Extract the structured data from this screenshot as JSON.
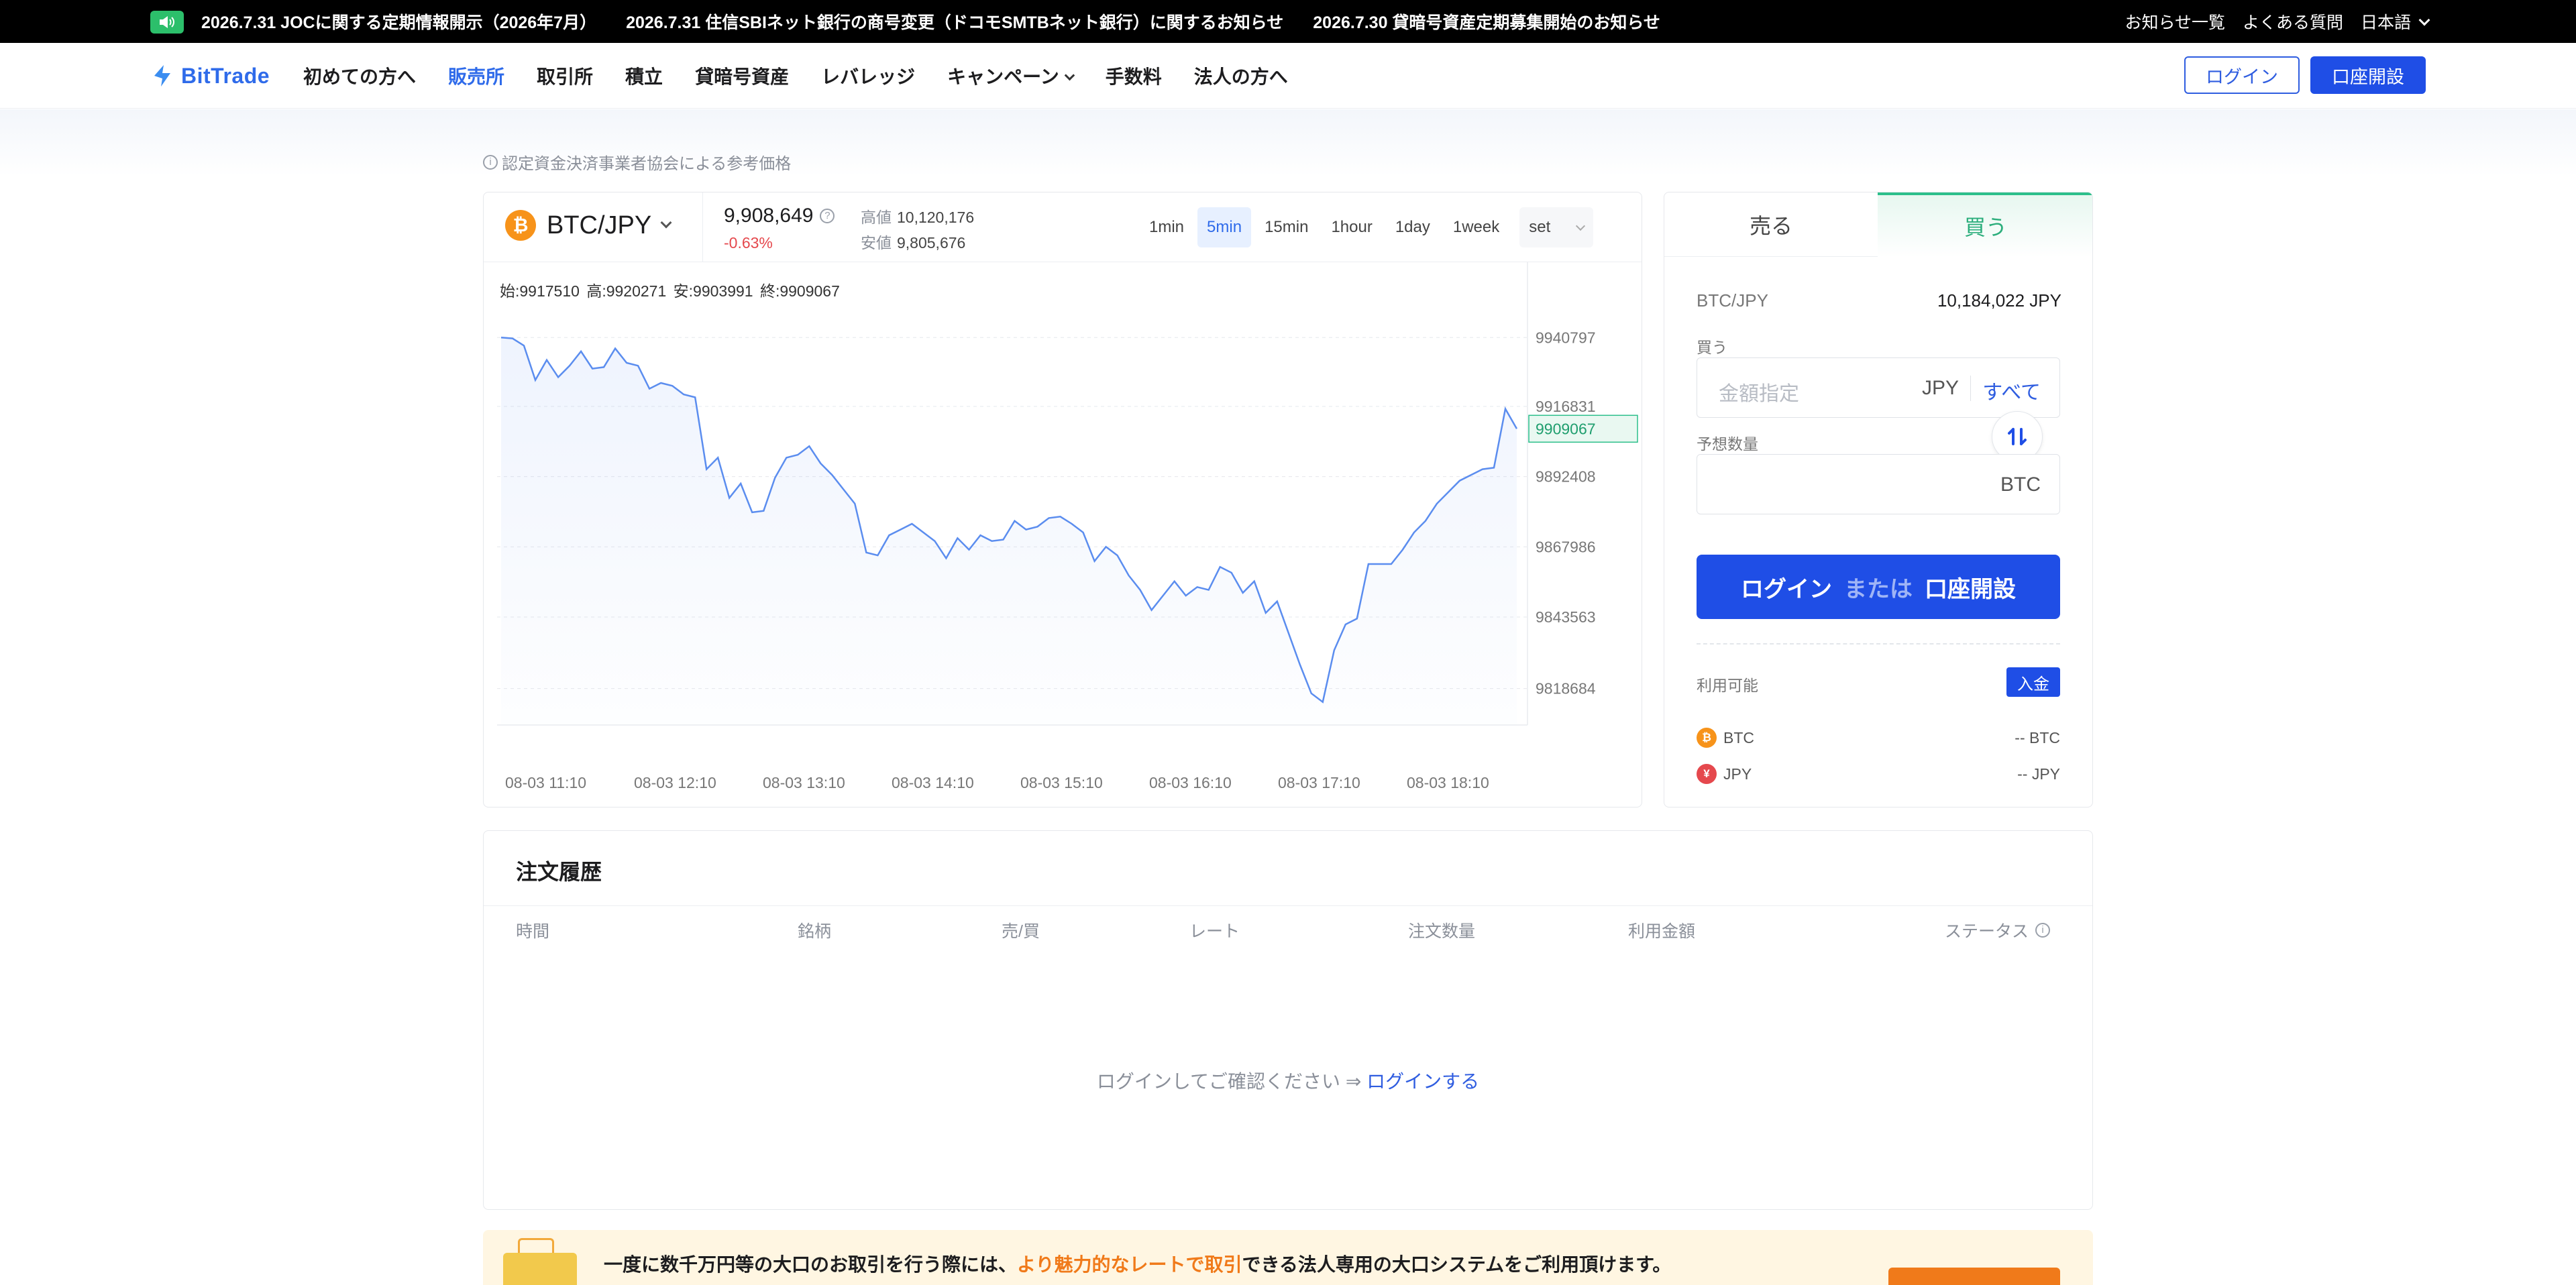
{
  "topbar": {
    "news": [
      "2026.7.31 JOCに関する定期情報開示（2026年7月）",
      "2026.7.31 住信SBIネット銀行の商号変更（ドコモSMTBネット銀行）に関するお知らせ",
      "2026.7.30 貸暗号資産定期募集開始のお知らせ"
    ],
    "links": [
      "お知らせ一覧",
      "よくある質問",
      "日本語"
    ]
  },
  "nav": {
    "logo": "BitTrade",
    "items": [
      "初めての方へ",
      "販売所",
      "取引所",
      "積立",
      "貸暗号資産",
      "レバレッジ",
      "キャンペーン",
      "手数料",
      "法人の方へ"
    ],
    "active_index": 1,
    "login": "ログイン",
    "open_account": "口座開設"
  },
  "ref_note": "認定資金決済事業者協会による参考価格",
  "ticker": {
    "pair": "BTC/JPY",
    "coin_symbol": "₿",
    "price": "9,908,649",
    "change": "-0.63%",
    "high_label": "高値",
    "high": "10,120,176",
    "low_label": "安値",
    "low": "9,805,676",
    "timeframes": [
      "1min",
      "5min",
      "15min",
      "1hour",
      "1day",
      "1week"
    ],
    "selected_timeframe": "5min",
    "set_label": "set"
  },
  "chart_data": {
    "type": "line",
    "ohlc": "始:9917510  高:9920271  安:9903991  終:9909067",
    "y_ticks": [
      9940797,
      9916831,
      9892408,
      9867986,
      9843563,
      9818684
    ],
    "last_value": 9909067,
    "x_tick_labels": [
      "08-03 11:10",
      "08-03 12:10",
      "08-03 13:10",
      "08-03 14:10",
      "08-03 15:10",
      "08-03 16:10",
      "08-03 17:10",
      "08-03 18:10"
    ],
    "ylim": [
      9806000,
      9967000
    ],
    "grid": true,
    "line_color": "#5b8def",
    "values": [
      9940800,
      9940500,
      9938000,
      9926000,
      9933000,
      9927000,
      9931000,
      9936000,
      9930000,
      9930500,
      9937000,
      9932000,
      9931000,
      9923000,
      9925000,
      9924000,
      9921000,
      9920000,
      9895000,
      9899000,
      9885000,
      9890000,
      9880000,
      9880500,
      9892000,
      9899000,
      9900000,
      9903000,
      9897000,
      9893000,
      9888000,
      9883000,
      9866000,
      9865000,
      9872000,
      9874000,
      9876000,
      9873000,
      9870000,
      9864000,
      9871000,
      9867000,
      9872000,
      9870000,
      9870500,
      9877000,
      9874000,
      9875000,
      9878000,
      9878500,
      9876000,
      9873000,
      9863000,
      9868000,
      9865000,
      9858000,
      9853000,
      9846000,
      9851000,
      9856000,
      9851000,
      9854000,
      9853000,
      9861000,
      9859000,
      9852000,
      9856000,
      9845000,
      9849000,
      9838000,
      9827000,
      9817000,
      9814000,
      9832000,
      9841000,
      9843000,
      9862000,
      9862000,
      9862000,
      9867000,
      9873000,
      9877000,
      9883000,
      9887000,
      9891000,
      9893000,
      9895000,
      9895500,
      9916000,
      9909067
    ]
  },
  "order": {
    "tab_sell": "売る",
    "tab_buy": "買う",
    "pair_label": "BTC/JPY",
    "pair_price": "10,184,022 JPY",
    "buy_label": "買う",
    "amount_placeholder": "金額指定",
    "amount_unit": "JPY",
    "all_label": "すべて",
    "qty_label": "予想数量",
    "qty_unit": "BTC",
    "cta_login": "ログイン",
    "cta_or": "または",
    "cta_open": "口座開設",
    "available_label": "利用可能",
    "deposit_label": "入金",
    "balances": [
      {
        "coin": "BTC",
        "symbol": "₿",
        "color": "#f7931a",
        "value": "-- BTC"
      },
      {
        "coin": "JPY",
        "symbol": "¥",
        "color": "#e5484d",
        "value": "-- JPY"
      }
    ]
  },
  "history": {
    "title": "注文履歴",
    "columns": [
      "時間",
      "銘柄",
      "売/買",
      "レート",
      "注文数量",
      "利用金額",
      "ステータス"
    ],
    "empty_text": "ログインしてご確認ください ⇒",
    "empty_link": "ログインする"
  },
  "promo": {
    "text_before": "一度に数千万円等の大口のお取引を行う際には、",
    "text_highlight": "より魅力的なレートで取引",
    "text_after": "できる法人専用の大口システムをご利用頂けます。"
  }
}
